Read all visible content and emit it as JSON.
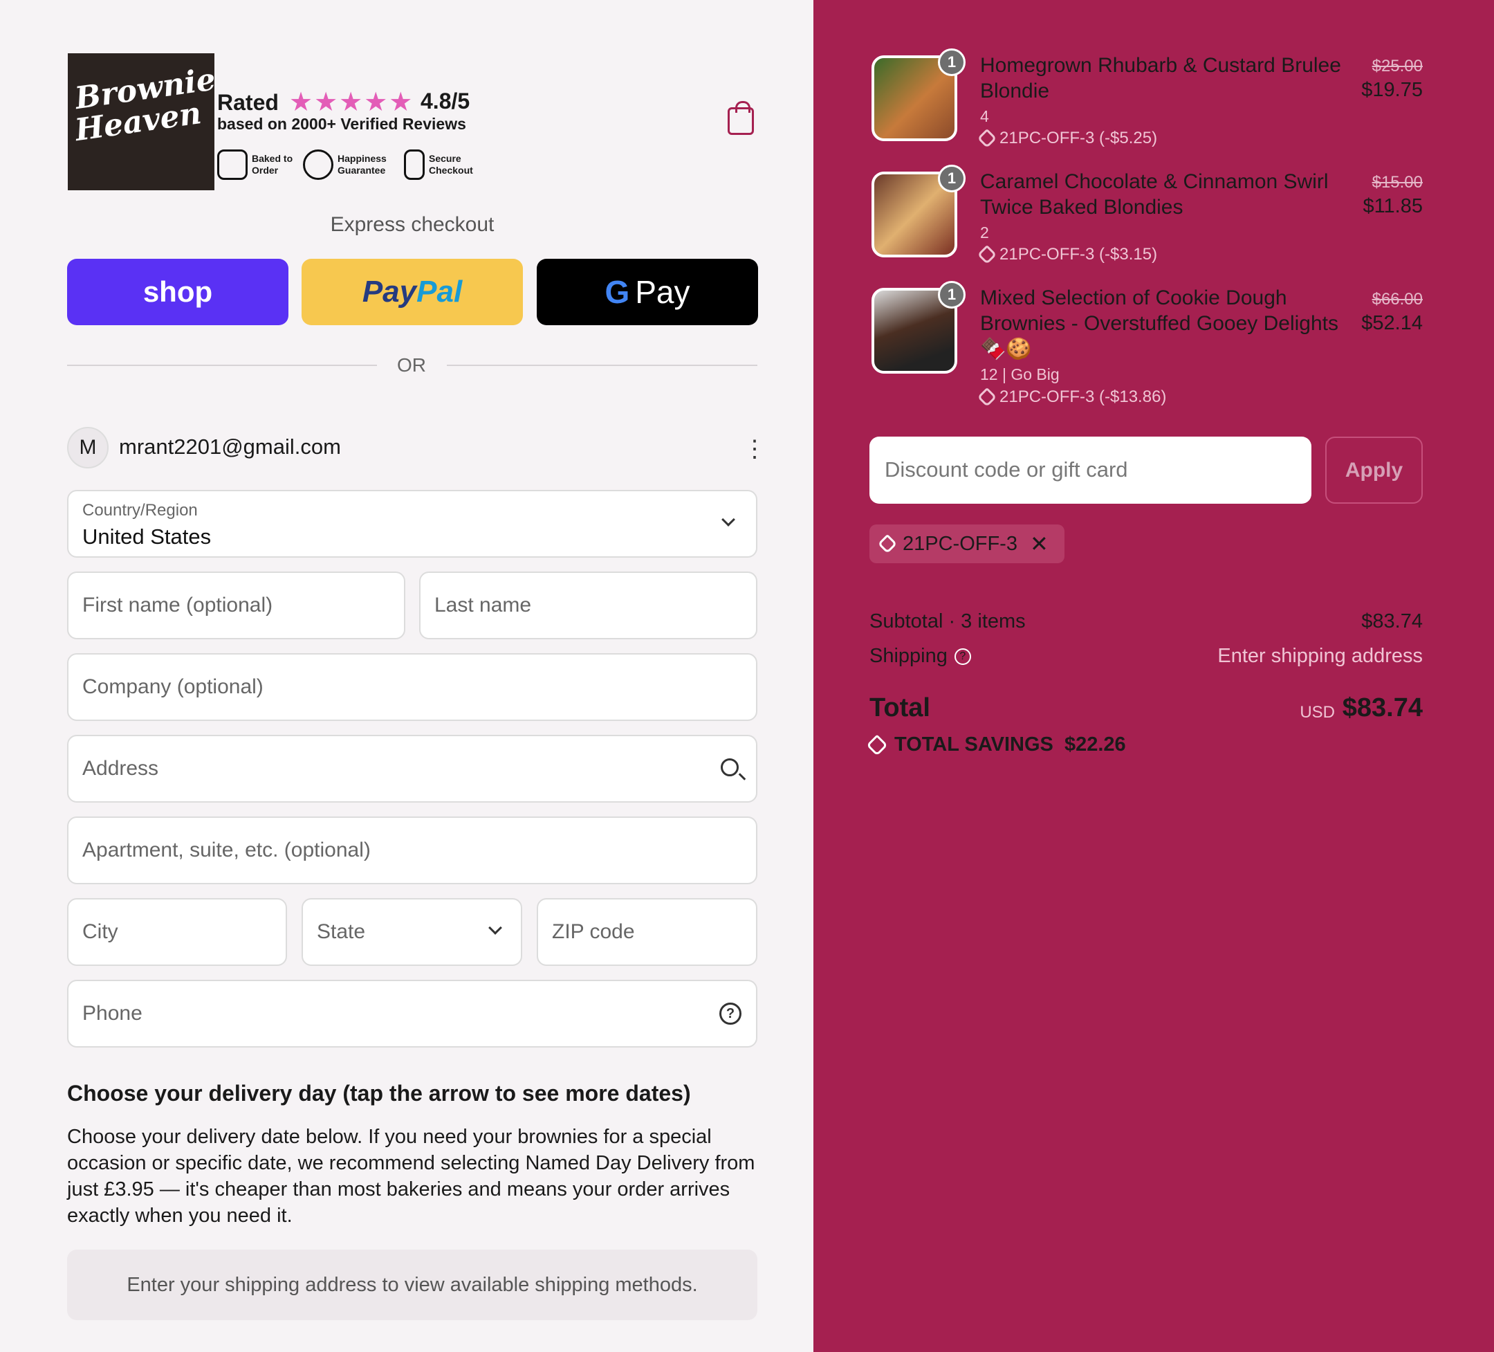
{
  "brand": {
    "logo_line1": "Brownie",
    "logo_line2": "Heaven"
  },
  "rating": {
    "label": "Rated",
    "stars": "★★★★★",
    "score": "4.8/5",
    "reviews": "based on 2000+ Verified Reviews"
  },
  "badges": [
    {
      "line1": "Baked to",
      "line2": "Order",
      "icon": "mixer-icon"
    },
    {
      "line1": "Happiness",
      "line2": "Guarantee",
      "icon": "heart-icon"
    },
    {
      "line1": "Secure",
      "line2": "Checkout",
      "icon": "lock-icon"
    }
  ],
  "express": {
    "title": "Express checkout",
    "shop": "shop",
    "paypal_a": "Pay",
    "paypal_b": "Pal",
    "gpay_g": "G",
    "gpay": "Pay",
    "or": "OR"
  },
  "account": {
    "initial": "M",
    "email": "mrant2201@gmail.com"
  },
  "form": {
    "country_label": "Country/Region",
    "country_value": "United States",
    "first_name": "First name (optional)",
    "last_name": "Last name",
    "company": "Company (optional)",
    "address": "Address",
    "apartment": "Apartment, suite, etc. (optional)",
    "city": "City",
    "state": "State",
    "zip": "ZIP code",
    "phone": "Phone"
  },
  "delivery": {
    "title": "Choose your delivery day (tap the arrow to see more dates)",
    "text": "Choose your delivery date below. If you need your brownies for a special occasion or specific date, we recommend selecting Named Day Delivery from just £3.95 — it's cheaper than most bakeries and means your order arrives exactly when you need it.",
    "shipping_notice": "Enter your shipping address to view available shipping methods."
  },
  "cart": {
    "items": [
      {
        "qty": "1",
        "name": "Homegrown Rhubarb & Custard Brulee Blondie",
        "variant": "4",
        "discount": "21PC-OFF-3 (-$5.25)",
        "old_price": "$25.00",
        "price": "$19.75"
      },
      {
        "qty": "1",
        "name": "Caramel Chocolate & Cinnamon Swirl Twice Baked Blondies",
        "variant": "2",
        "discount": "21PC-OFF-3 (-$3.15)",
        "old_price": "$15.00",
        "price": "$11.85"
      },
      {
        "qty": "1",
        "name": "Mixed Selection of Cookie Dough Brownies - Overstuffed Gooey Delights 🍫🍪",
        "variant": "12 | Go Big",
        "discount": "21PC-OFF-3 (-$13.86)",
        "old_price": "$66.00",
        "price": "$52.14"
      }
    ],
    "discount_placeholder": "Discount code or gift card",
    "apply": "Apply",
    "applied_code": "21PC-OFF-3",
    "subtotal_label": "Subtotal · 3 items",
    "subtotal": "$83.74",
    "shipping_label": "Shipping",
    "shipping_value": "Enter shipping address",
    "total_label": "Total",
    "currency": "USD",
    "total": "$83.74",
    "savings": "TOTAL SAVINGS  $22.26"
  },
  "colors": {
    "accent": "#a52050",
    "shop": "#5a31f4",
    "paypal": "#f7c84f",
    "star": "#e35db7"
  }
}
